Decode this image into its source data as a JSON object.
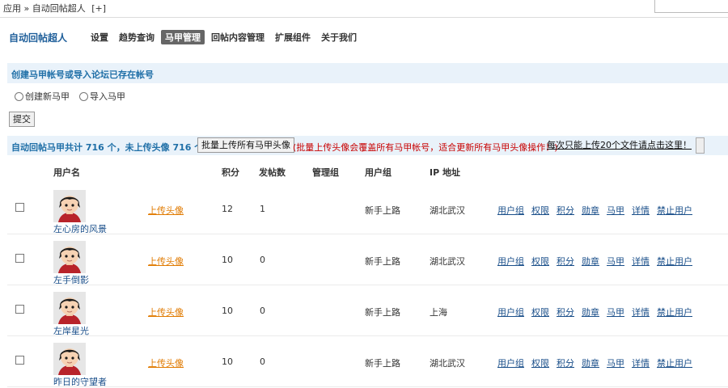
{
  "breadcrumb": {
    "root": "应用",
    "sep": "»",
    "current": "自动回帖超人",
    "add": "[+]"
  },
  "app_title": "自动回帖超人",
  "nav": [
    "设置",
    "趋势查询",
    "马甲管理",
    "回帖内容管理",
    "扩展组件",
    "关于我们"
  ],
  "nav_active_index": 2,
  "create_section": {
    "title": "创建马甲帐号或导入论坛已存在帐号",
    "options": [
      "创建新马甲",
      "导入马甲"
    ],
    "submit": "提交"
  },
  "stats": {
    "summary": "自动回帖马甲共计 716 个，未上传头像 716 个",
    "bulk_button": "批量上传所有马甲头像",
    "warning": "(批量上传头像会覆盖所有马甲帐号，适合更新所有马甲头像操作！)",
    "note_button": "每次只能上传20个文件请点击这里！"
  },
  "table": {
    "headers": [
      "用户名",
      "积分",
      "发帖数",
      "管理组",
      "用户组",
      "IP 地址"
    ],
    "upload_label": "上传头像",
    "actions": [
      "用户组",
      "权限",
      "积分",
      "勋章",
      "马甲",
      "详情",
      "禁止用户"
    ],
    "rows": [
      {
        "name": "左心房的风景",
        "points": "12",
        "posts": "1",
        "group": "新手上路",
        "ip": "湖北武汉"
      },
      {
        "name": "左手倒影",
        "points": "10",
        "posts": "0",
        "group": "新手上路",
        "ip": "湖北武汉"
      },
      {
        "name": "左岸星光",
        "points": "10",
        "posts": "0",
        "group": "新手上路",
        "ip": "上海"
      },
      {
        "name": "昨日的守望者",
        "points": "10",
        "posts": "0",
        "group": "新手上路",
        "ip": "湖北武汉"
      }
    ]
  },
  "colors": {
    "accent": "#1f6fa7",
    "link": "#1a4f8a",
    "upload": "#e07a00",
    "warning": "#c80000",
    "section_bg": "#e9f2fa"
  }
}
